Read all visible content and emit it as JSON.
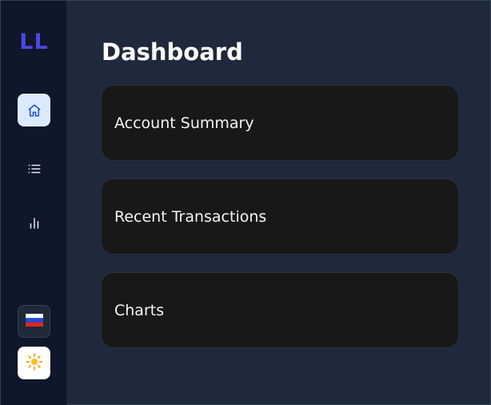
{
  "app": {
    "logo": "LL"
  },
  "sidebar": {
    "nav": [
      {
        "icon": "home-icon",
        "active": true
      },
      {
        "icon": "list-icon",
        "active": false
      },
      {
        "icon": "bar-chart-icon",
        "active": false
      }
    ],
    "language_icon": "russian-flag-icon",
    "theme_icon": "sun-icon"
  },
  "main": {
    "title": "Dashboard",
    "cards": [
      {
        "label": "Account Summary"
      },
      {
        "label": "Recent Transactions"
      },
      {
        "label": "Charts"
      }
    ]
  },
  "colors": {
    "background": "#1e293b",
    "sidebar": "#0f172a",
    "accent": "#4f46e5",
    "active_nav": "#dbeafe",
    "card": "#181818"
  }
}
